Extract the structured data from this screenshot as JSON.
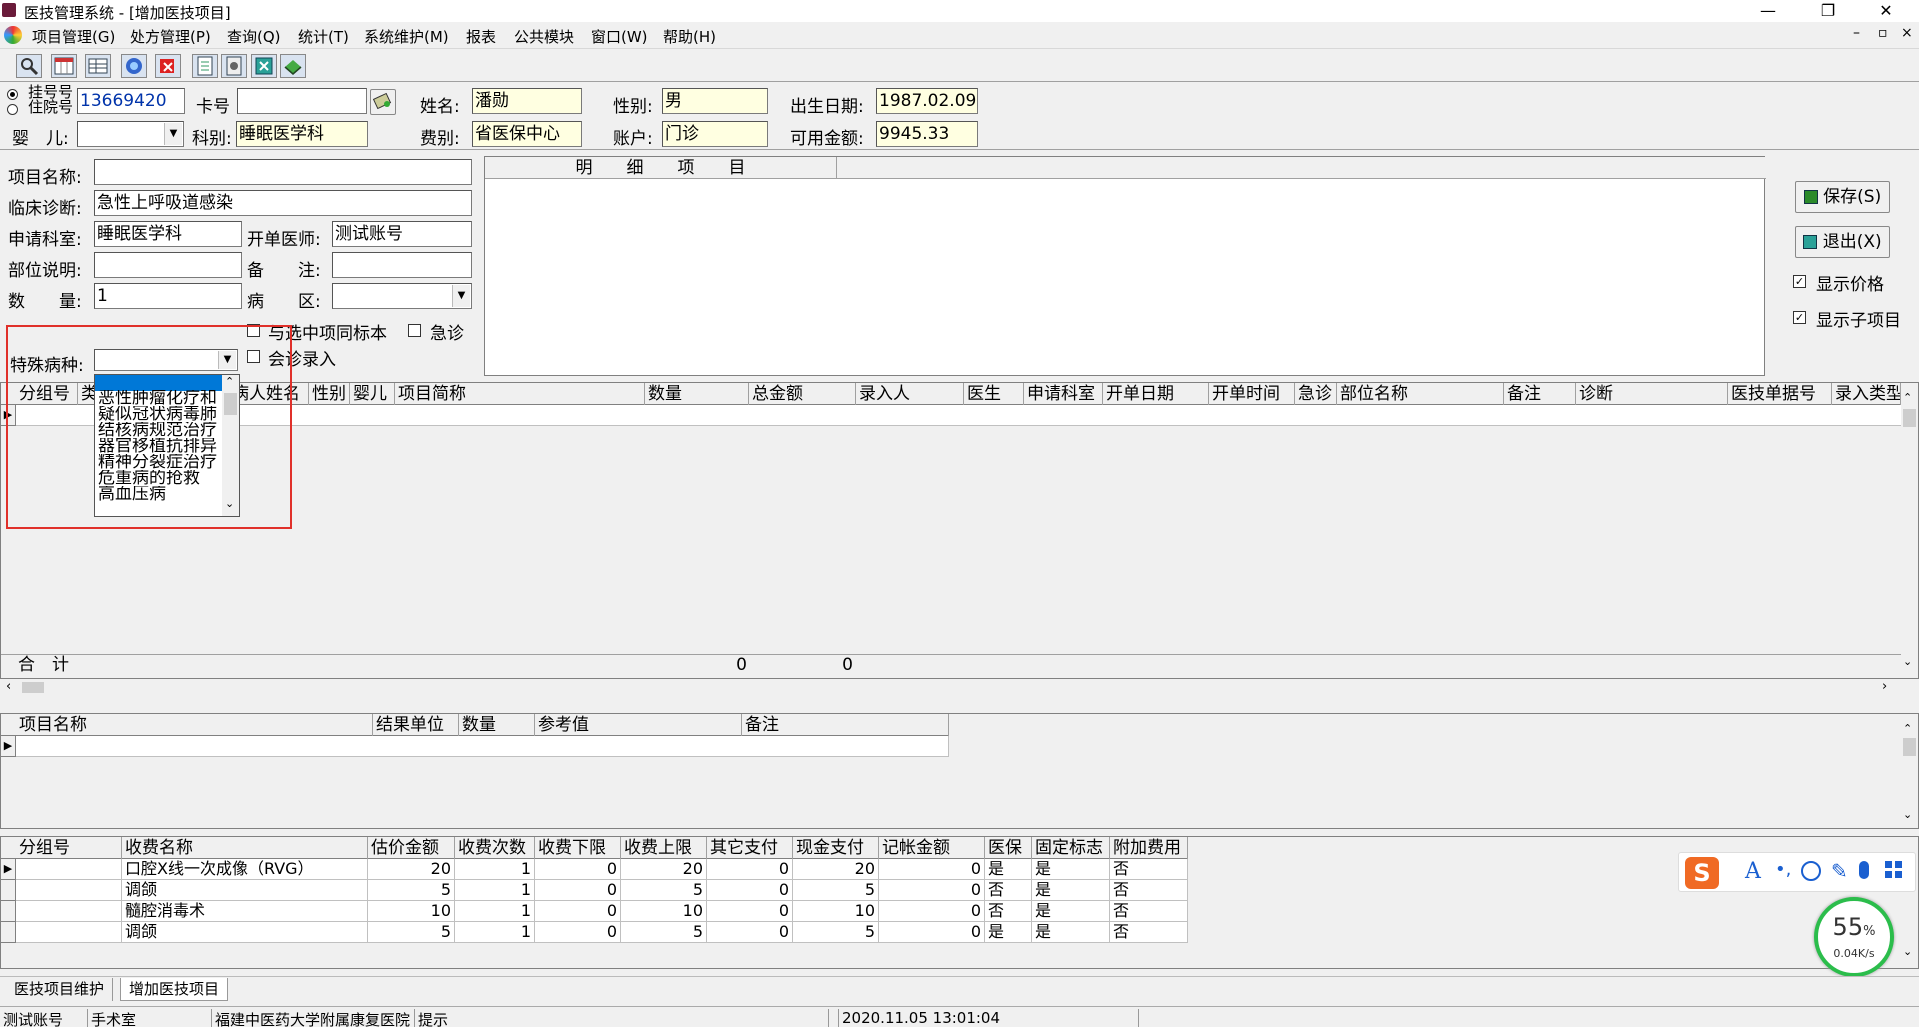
{
  "title": "医技管理系统 - [增加医技项目]",
  "menus": [
    "项目管理(G)",
    "处方管理(P)",
    "查询(Q)",
    "统计(T)",
    "系统维护(M)",
    "报表",
    "公共模块",
    "窗口(W)",
    "帮助(H)"
  ],
  "win_controls": [
    "—",
    "❐",
    "✕"
  ],
  "mdi_controls": [
    "–",
    "▫",
    "×"
  ],
  "patient": {
    "radio1": "挂号号",
    "radio2": "住院号",
    "reg_no": "13669420",
    "card_label": "卡号",
    "card_value": "",
    "name_label": "姓名:",
    "name": "潘勋",
    "gender_label": "性别:",
    "gender": "男",
    "dob_label": "出生日期:",
    "dob": "1987.02.09",
    "baby_label": "婴　儿:",
    "baby": "",
    "dept_label": "科别:",
    "dept": "睡眠医学科",
    "fee_label": "费别:",
    "fee": "省医保中心",
    "account_label": "账户:",
    "account": "门诊",
    "balance_label": "可用金额:",
    "balance": "9945.33"
  },
  "form": {
    "item_name_label": "项目名称:",
    "item_name": "",
    "diag_label": "临床诊断:",
    "diag": "急性上呼吸道感染",
    "apply_dept_label": "申请科室:",
    "apply_dept": "睡眠医学科",
    "doctor_label": "开单医师:",
    "doctor": "测试账号",
    "part_label": "部位说明:",
    "part": "",
    "remark_label": "备　　注:",
    "remark": "",
    "qty_label": "数　　量:",
    "qty": "1",
    "ward_label": "病　　区:",
    "ward": "",
    "same_sample": "与选中项同标本",
    "urgent": "急诊",
    "consult": "会诊录入",
    "special_label": "特殊病种:",
    "special": ""
  },
  "dropdown_options": [
    "恶性肿瘤化疗和",
    "疑似冠状病毒肺",
    "结核病规范治疗",
    "器官移植抗排异",
    "精神分裂症治疗",
    "危重病的抢救",
    "高血压病"
  ],
  "detail_header": "明　　细　　项　　目",
  "buttons": {
    "save": "保存(S)",
    "exit": "退出(X)"
  },
  "options": {
    "show_price": "显示价格",
    "show_sub": "显示子项目"
  },
  "grid1": {
    "columns": [
      "分组号",
      "类",
      "",
      "病人姓名",
      "性别",
      "婴儿",
      "项目简称",
      "数量",
      "总金额",
      "录入人",
      "医生",
      "申请科室",
      "开单日期",
      "开单时间",
      "急诊",
      "部位名称",
      "备注",
      "诊断",
      "医技单据号",
      "录入类型"
    ],
    "total_label": "合　计",
    "total_qty": "0",
    "total_amount": "0"
  },
  "grid2": {
    "columns": [
      "项目名称",
      "结果单位",
      "数量",
      "参考值",
      "备注"
    ]
  },
  "grid3": {
    "columns": [
      "分组号",
      "收费名称",
      "估价金额",
      "收费次数",
      "收费下限",
      "收费上限",
      "其它支付",
      "现金支付",
      "记帐金额",
      "医保",
      "固定标志",
      "附加费用"
    ],
    "rows": [
      [
        "",
        "口腔X线一次成像（RVG）",
        "20",
        "1",
        "0",
        "20",
        "0",
        "20",
        "0",
        "是",
        "是",
        "否"
      ],
      [
        "",
        "调颌",
        "5",
        "1",
        "0",
        "5",
        "0",
        "5",
        "0",
        "否",
        "是",
        "否"
      ],
      [
        "",
        "髓腔消毒术",
        "10",
        "1",
        "0",
        "10",
        "0",
        "10",
        "0",
        "否",
        "是",
        "否"
      ],
      [
        "",
        "调颌",
        "5",
        "1",
        "0",
        "5",
        "0",
        "5",
        "0",
        "是",
        "是",
        "否"
      ]
    ]
  },
  "tabs": [
    "医技项目维护",
    "增加医技项目"
  ],
  "status": [
    "测试账号",
    "手术室",
    "福建中医药大学附属康复医院",
    "提示",
    "",
    "2020.11.05 13:01:04"
  ],
  "ime": {
    "percent": "55",
    "unit": "%",
    "speed": "0.04K/s",
    "logo": "S"
  },
  "colors": {
    "highlight": "#0078d7",
    "readonly": "#ffffe1",
    "red": "#e0302a",
    "ring": "#2bbd4b"
  }
}
